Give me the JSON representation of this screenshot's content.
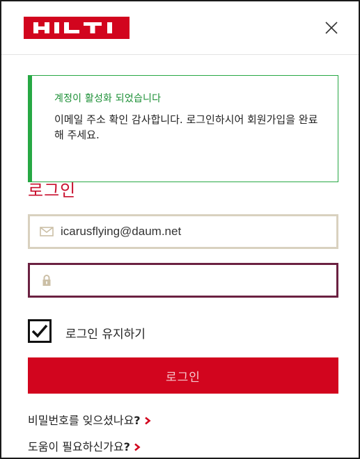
{
  "header": {
    "logo_text": "HILTI",
    "brand_color": "#d2051e"
  },
  "alert": {
    "title": "계정이 활성화 되었습니다",
    "message": "이메일 주소 확인 감사합니다. 로그인하시어 회원가입을 완료해 주세요.",
    "accent_color": "#27a844"
  },
  "login": {
    "heading": "로그인",
    "email_value": "icarusflying@daum.net",
    "password_value": "",
    "remember_label": "로그인 유지하기",
    "remember_checked": true,
    "submit_label": "로그인"
  },
  "links": {
    "forgot_text": "비밀번호를 잊으셨나요",
    "forgot_mark": "?",
    "help_text": "도움이 필요하신가요",
    "help_mark": "?"
  },
  "icons": {
    "close": "close-icon",
    "email": "envelope-icon",
    "password": "lock-icon",
    "checkbox": "checkmark-icon",
    "chevron": "chevron-right-icon"
  }
}
